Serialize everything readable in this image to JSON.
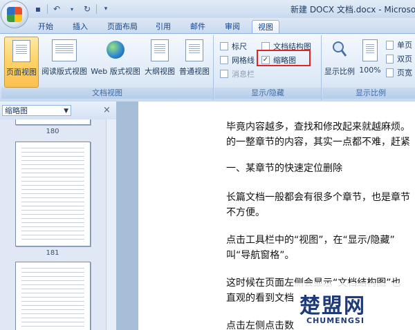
{
  "window": {
    "title": "新建 DOCX 文档.docx - Microsoft"
  },
  "quick_access": {
    "save_icon": "save-icon",
    "undo_icon": "undo-icon",
    "redo_icon": "redo-icon",
    "customize_icon": "customize-icon"
  },
  "tabs": [
    "开始",
    "插入",
    "页面布局",
    "引用",
    "邮件",
    "审阅",
    "视图"
  ],
  "active_tab": "视图",
  "ribbon": {
    "document_views": {
      "label": "文档视图",
      "buttons": [
        "页面视图",
        "阅读版式视图",
        "Web 版式视图",
        "大纲视图",
        "普通视图"
      ]
    },
    "show_hide": {
      "label": "显示/隐藏",
      "ruler": {
        "label": "标尺",
        "checked": false
      },
      "gridlines": {
        "label": "网格线",
        "checked": false
      },
      "message_bar": {
        "label": "消息栏",
        "checked": false
      },
      "doc_map": {
        "label": "文档结构图",
        "checked": false
      },
      "thumbnails": {
        "label": "缩略图",
        "checked": true,
        "check_mark": "✓"
      }
    },
    "zoom": {
      "label": "显示比例",
      "zoom_button": "显示比例",
      "percent_button": "100%",
      "one_page": "单页",
      "two_pages": "双页",
      "page_width": "页宽"
    }
  },
  "nav_pane": {
    "selector": "缩略图",
    "close": "×",
    "page_numbers": [
      "180",
      "181"
    ]
  },
  "document": {
    "paragraphs": [
      "毕竟内容越多，查找和修改起来就越麻烦。",
      "的一整章节的内容，其实一点都不难，赶紧",
      "一、某章节的快速定位删除",
      "长篇文档一般都会有很多个章节，也是章节",
      "不方便。",
      "点击工具栏中的“视图”，在“显示/隐藏”",
      "叫“导航窗格”。",
      "这时候在页面左侧会显示“文档结构图”也",
      "直观的看到文档",
      "点击左侧点击数"
    ]
  },
  "watermark": {
    "main": "楚盟网",
    "sub": "CHUMENGSI"
  }
}
